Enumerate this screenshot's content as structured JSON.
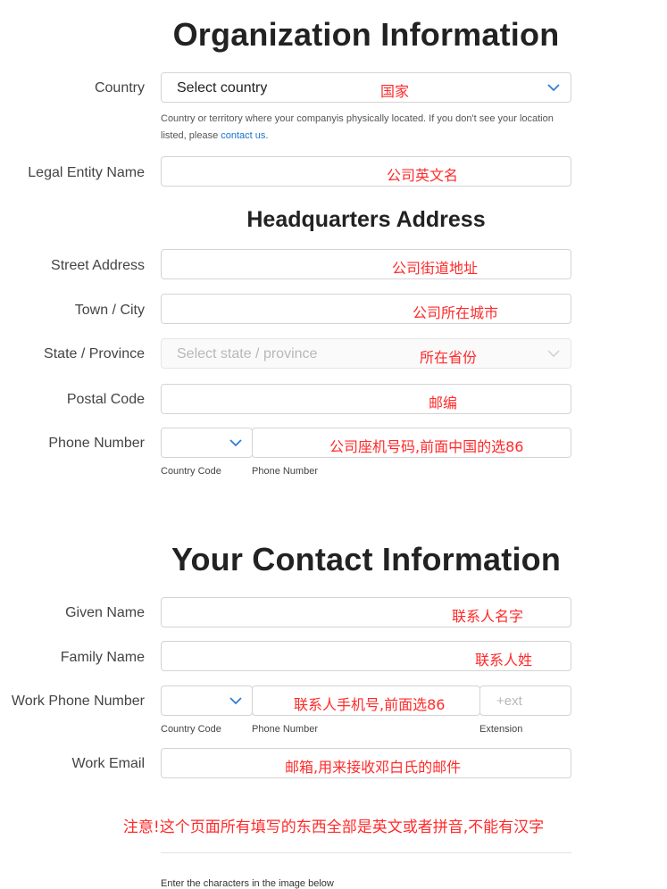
{
  "org": {
    "title": "Organization Information",
    "country_label": "Country",
    "country_value": "Select country",
    "country_anno": "国家",
    "help_text": "Country or territory where your companyis physically located. If you don't see your location listed, please ",
    "help_link": "contact us",
    "help_end": ".",
    "legal_label": "Legal Entity Name",
    "legal_anno": "公司英文名"
  },
  "hq": {
    "title": "Headquarters Address",
    "street_label": "Street Address",
    "street_anno": "公司街道地址",
    "city_label": "Town / City",
    "city_anno": "公司所在城市",
    "state_label": "State / Province",
    "state_placeholder": "Select state / province",
    "state_anno": "所在省份",
    "postal_label": "Postal Code",
    "postal_anno": "邮编",
    "phone_label": "Phone Number",
    "phone_anno": "公司座机号码,前面中国的选86",
    "country_code_caption": "Country Code",
    "phone_number_caption": "Phone Number"
  },
  "contact": {
    "title": "Your Contact Information",
    "given_label": "Given Name",
    "given_anno": "联系人名字",
    "family_label": "Family Name",
    "family_anno": "联系人姓",
    "work_phone_label": "Work Phone Number",
    "work_phone_anno": "联系人手机号,前面选86",
    "ext_placeholder": "+ext",
    "country_code_caption": "Country Code",
    "phone_number_caption": "Phone Number",
    "extension_caption": "Extension",
    "email_label": "Work Email",
    "email_anno": "邮箱,用来接收邓白氏的邮件"
  },
  "note": "注意!这个页面所有填写的东西全部是英文或者拼音,不能有汉字",
  "captcha_text": "Enter the characters in the image below",
  "colors": {
    "annotation": "#ff2a2a",
    "link": "#1a73c9",
    "chevron": "#2f7fd1"
  },
  "icons": {
    "dropdown": "chevron-down-icon"
  }
}
